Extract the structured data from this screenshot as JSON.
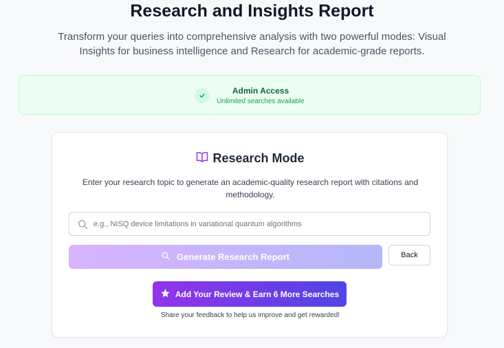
{
  "header": {
    "title": "Research and Insights Report",
    "subtitle": "Transform your queries into comprehensive analysis with two powerful modes: Visual Insights for business intelligence and Research for academic-grade reports."
  },
  "admin": {
    "title": "Admin Access",
    "subtitle": "Unlimited searches available",
    "icon": "check-icon"
  },
  "research": {
    "mode_title": "Research Mode",
    "mode_icon": "book-open-icon",
    "description": "Enter your research topic to generate an academic-quality research report with citations and methodology.",
    "search_placeholder": "e.g., NISQ device limitations in variational quantum algorithms",
    "search_value": "",
    "generate_label": "Generate Research Report",
    "back_label": "Back"
  },
  "review": {
    "button_label": "Add Your Review & Earn 6 More Searches",
    "note": "Share your feedback to help us improve and get rewarded!"
  },
  "colors": {
    "accent_purple": "#9333ea",
    "accent_indigo": "#4f46e5",
    "success_green": "#16a34a"
  }
}
